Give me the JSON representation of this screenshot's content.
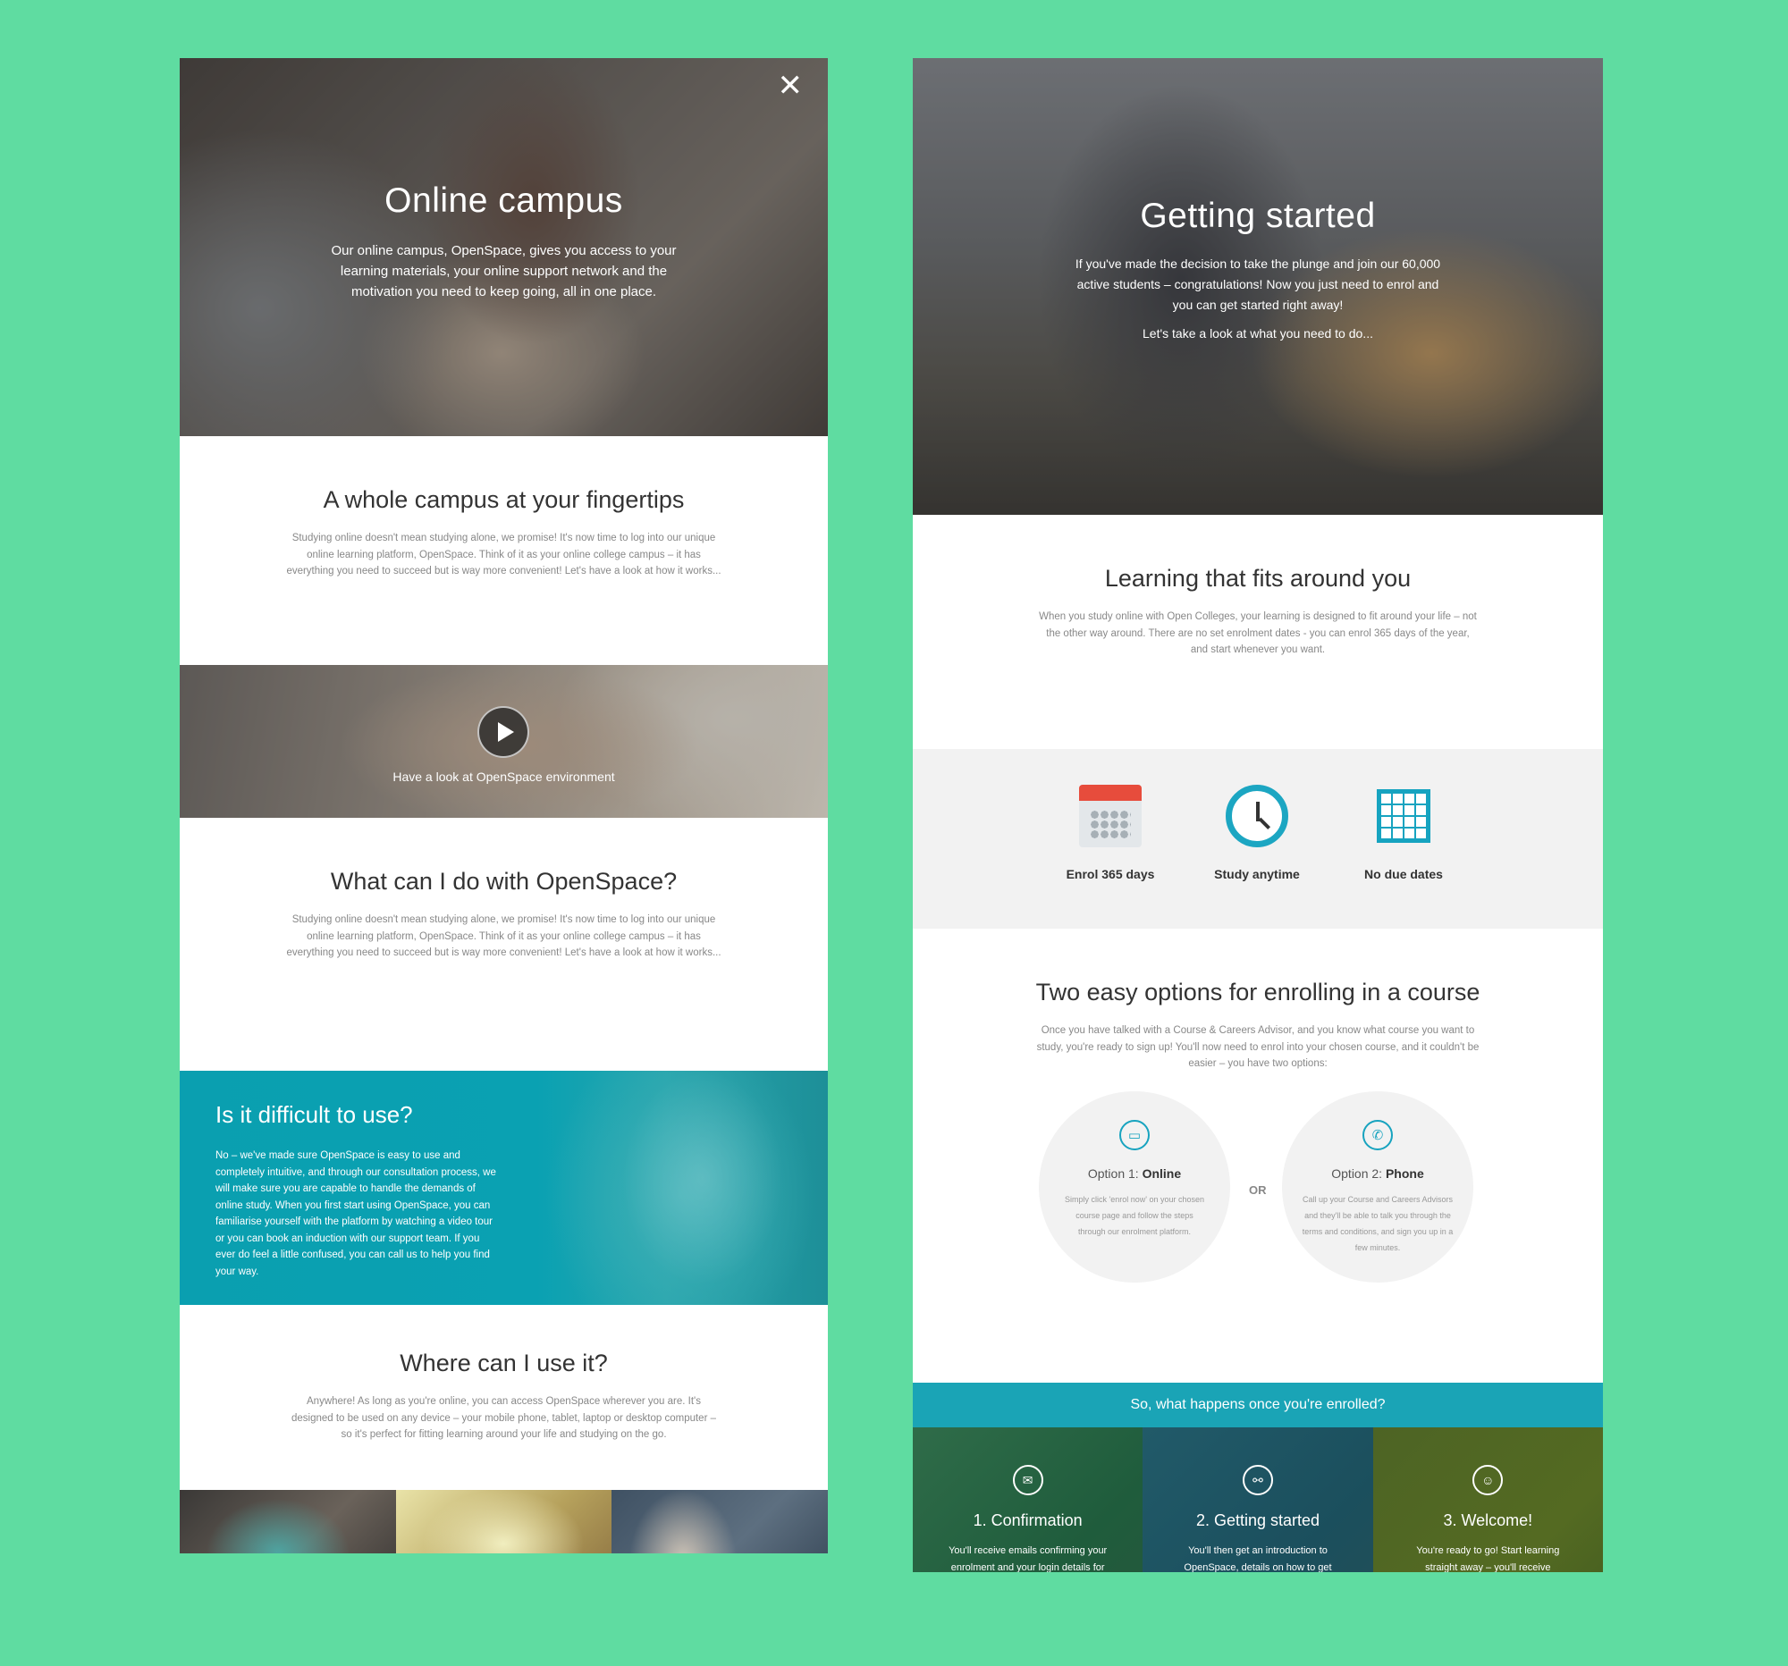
{
  "left": {
    "hero": {
      "title": "Online campus",
      "text": "Our online campus, OpenSpace, gives you access to your learning materials, your online support network and the motivation you need to keep going, all in one place.",
      "close_glyph": "✕"
    },
    "section1": {
      "title": "A whole campus at your fingertips",
      "body": "Studying online doesn't mean studying alone, we promise! It's now time to log into our unique online learning platform, OpenSpace. Think of it as your online college campus – it has everything you need to succeed but is way more convenient! Let's have a look at how it works..."
    },
    "video": {
      "caption": "Have a look at OpenSpace environment"
    },
    "section2": {
      "title": "What can I do with OpenSpace?",
      "body": "Studying online doesn't mean studying alone, we promise! It's now time to log into our unique online learning platform, OpenSpace. Think of it as your online college campus – it has everything you need to succeed but is way more convenient! Let's have a look at how it works..."
    },
    "teal": {
      "title": "Is it difficult to use?",
      "body": "No – we've made sure OpenSpace is easy to use and completely intuitive, and through our consultation process, we will make sure you are capable to handle the demands of online study. When you first start using OpenSpace, you can familiarise yourself with the platform by watching a video tour or you can book an induction with our support team. If you ever do feel a little confused, you can call us to help you find your way."
    },
    "section3": {
      "title": "Where can I use it?",
      "body": "Anywhere! As long as you're online, you can access OpenSpace wherever you are. It's designed to be used on any device – your mobile phone, tablet, laptop or desktop computer – so it's perfect for fitting learning around your life and studying on the go."
    }
  },
  "right": {
    "hero": {
      "title": "Getting started",
      "text": "If you've made the decision to take the plunge and join our 60,000 active students – congratulations! Now you just need to enrol and you can get started right away!",
      "text2": "Let's take a look at what you need to do..."
    },
    "section1": {
      "title": "Learning that fits around you",
      "body": "When you study online with Open Colleges, your learning is designed to fit around your life – not the other way around. There are no set enrolment dates - you can enrol 365 days of the year, and start whenever you want."
    },
    "features": [
      {
        "label": "Enrol 365 days",
        "icon": "calendar-icon"
      },
      {
        "label": "Study anytime",
        "icon": "clock-icon"
      },
      {
        "label": "No due dates",
        "icon": "grid-calendar-icon"
      }
    ],
    "options": {
      "title": "Two easy options for enrolling in a course",
      "body": "Once you have talked with a Course & Careers Advisor, and you know what course you want to study, you're ready to sign up! You'll now need to enrol into your chosen course, and it couldn't be easier – you have two options:",
      "or": "OR",
      "items": [
        {
          "prefix": "Option 1: ",
          "name": "Online",
          "body": "Simply click 'enrol now' on your chosen course page and follow the steps through our enrolment platform.",
          "icon_glyph": "▭"
        },
        {
          "prefix": "Option 2: ",
          "name": "Phone",
          "body": "Call up your Course and Careers Advisors and they'll be able to talk you through the terms and conditions, and sign you up in a few minutes.",
          "icon_glyph": "✆"
        }
      ]
    },
    "banner": "So, what happens once you're enrolled?",
    "steps": [
      {
        "title": "1. Confirmation",
        "body": "You'll receive emails confirming your enrolment and your login details for our online learning platform, OpenSpace.",
        "icon_glyph": "✉"
      },
      {
        "title": "2. Getting started",
        "body": "You'll then get an introduction to OpenSpace, details on how to get started and information about the kinds of support that are available. You can always give us a call if you're still unsure.",
        "icon_glyph": "⚯"
      },
      {
        "title": "3. Welcome!",
        "body": "You're ready to go! Start learning straight away – you'll receive notifications about setting up a study schedule and finding study resources to get the most out of your course.",
        "icon_glyph": "☺"
      }
    ],
    "colors": {
      "teal": "#1aa4b6",
      "background": "#5fdca1"
    }
  }
}
